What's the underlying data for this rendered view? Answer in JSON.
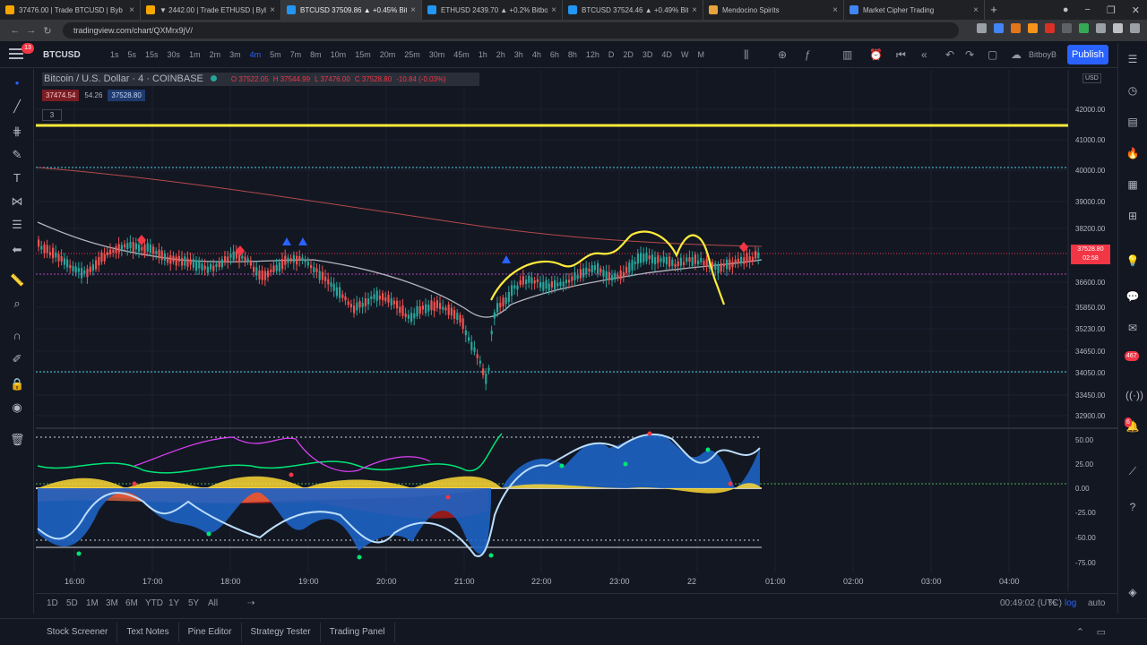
{
  "browser": {
    "tabs": [
      {
        "title": "37476.00 | Trade BTCUSD | Byb",
        "color": "#f7a600",
        "active": false
      },
      {
        "title": "▼ 2442.00 | Trade ETHUSD | Bybi",
        "color": "#f7a600",
        "active": false
      },
      {
        "title": "BTCUSD 37509.86 ▲ +0.45% Bitb",
        "color": "#2196f3",
        "active": true
      },
      {
        "title": "ETHUSD 2439.70 ▲ +0.2% Bitbo",
        "color": "#2196f3",
        "active": false
      },
      {
        "title": "BTCUSD 37524.46 ▲ +0.49% Bit",
        "color": "#2196f3",
        "active": false
      },
      {
        "title": "Mendocino Spirits",
        "color": "#e8a33d",
        "active": false
      },
      {
        "title": "Market Cipher Trading",
        "color": "#4285f4",
        "active": false
      }
    ],
    "new_tab": "+",
    "url": "tradingview.com/chart/QXMrx9jV/"
  },
  "toolbar": {
    "notifications": "13",
    "symbol": "BTCUSD",
    "intervals": [
      "1s",
      "5s",
      "15s",
      "30s",
      "1m",
      "2m",
      "3m",
      "4m",
      "5m",
      "7m",
      "8m",
      "10m",
      "15m",
      "20m",
      "25m",
      "30m",
      "45m",
      "1h",
      "2h",
      "3h",
      "4h",
      "6h",
      "8h",
      "12h",
      "D",
      "2D",
      "3D",
      "4D",
      "W",
      "M"
    ],
    "selected_interval": "4m",
    "account": "BitboyB",
    "publish": "Publish"
  },
  "legend": {
    "title": "Bitcoin / U.S. Dollar · 4 · COINBASE",
    "ohlc": [
      "O 37522.05",
      "H 37544.99",
      "L 37476.00",
      "C 37528.80",
      "-10.84 (-0.03%)"
    ],
    "bid": "37474.54",
    "spread": "54.26",
    "ask": "37528.80",
    "indicators_collapsed": "3"
  },
  "price_axis": {
    "currency": "USD",
    "labels": [
      "42000.00",
      "41000.00",
      "40000.00",
      "39000.00",
      "38200.00",
      "36600.00",
      "35850.00",
      "35230.00",
      "34650.00",
      "34050.00",
      "33450.00",
      "32900.00"
    ],
    "current_price": "37528.80",
    "countdown": "02:58"
  },
  "oscillator_axis": {
    "labels": [
      "50.00",
      "25.00",
      "0.00",
      "-25.00",
      "-50.00",
      "-75.00"
    ]
  },
  "time_axis": {
    "labels": [
      "16:00",
      "17:00",
      "18:00",
      "19:00",
      "20:00",
      "21:00",
      "22:00",
      "23:00",
      "22",
      "01:00",
      "02:00",
      "03:00",
      "04:00"
    ]
  },
  "range_bar": {
    "ranges": [
      "1D",
      "5D",
      "1M",
      "3M",
      "6M",
      "YTD",
      "1Y",
      "5Y",
      "All"
    ],
    "clock": "00:49:02 (UTC)",
    "percent": "%",
    "log": "log",
    "auto": "auto"
  },
  "bottom_panel": {
    "tabs": [
      "Stock Screener",
      "Text Notes",
      "Pine Editor",
      "Strategy Tester",
      "Trading Panel"
    ]
  },
  "right_sidebar": {
    "badge_alerts": "467",
    "badge_notifications": "6"
  },
  "colors": {
    "up": "#26a69a",
    "down": "#ef5350",
    "resistance_line": "#ffeb3b",
    "accent": "#2962ff"
  }
}
